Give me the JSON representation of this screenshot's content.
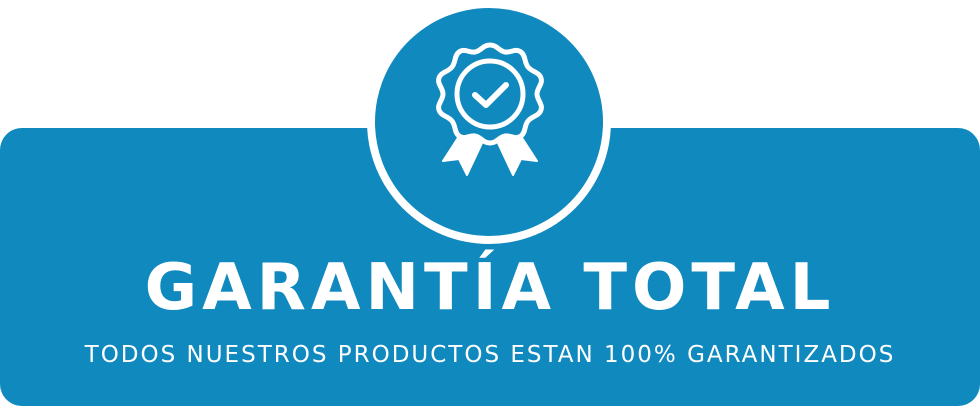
{
  "banner": {
    "title": "GARANTÍA TOTAL",
    "subtitle": "TODOS NUESTROS PRODUCTOS ESTAN 100% GARANTIZADOS",
    "icon": "award-badge-check-icon"
  },
  "colors": {
    "primary": "#1089bf",
    "text": "#ffffff",
    "ring": "#ffffff"
  }
}
